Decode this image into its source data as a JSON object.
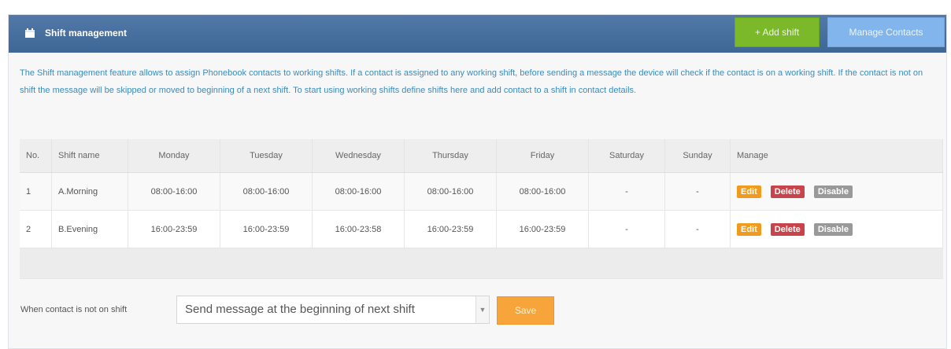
{
  "header": {
    "title": "Shift management",
    "icon": "calendar-icon",
    "add_label": "+ Add shift",
    "manage_label": "Manage Contacts"
  },
  "description": "The Shift management feature allows to assign Phonebook contacts to working shifts. If a contact is assigned to any working shift, before sending a message the device will check if the contact is on a working shift. If the contact is not on shift the message will be skipped or moved to beginning of a next shift. To start using working shifts define shifts here and add contact to a shift in contact details.",
  "table": {
    "columns": [
      "No.",
      "Shift name",
      "Monday",
      "Tuesday",
      "Wednesday",
      "Thursday",
      "Friday",
      "Saturday",
      "Sunday",
      "Manage"
    ],
    "rows": [
      {
        "no": "1",
        "name": "A.Morning",
        "mon": "08:00-16:00",
        "tue": "08:00-16:00",
        "wed": "08:00-16:00",
        "thu": "08:00-16:00",
        "fri": "08:00-16:00",
        "sat": "-",
        "sun": "-"
      },
      {
        "no": "2",
        "name": "B.Evening",
        "mon": "16:00-23:59",
        "tue": "16:00-23:59",
        "wed": "16:00-23:58",
        "thu": "16:00-23:59",
        "fri": "16:00-23:59",
        "sat": "-",
        "sun": "-"
      }
    ],
    "actions": {
      "edit": "Edit",
      "delete": "Delete",
      "disable": "Disable"
    }
  },
  "footer": {
    "label": "When contact is not on shift",
    "selected": "Send message at the beginning of next shift",
    "save_label": "Save"
  },
  "colors": {
    "header_bg": "#4a72a0",
    "add_button": "#7bb82a",
    "manage_button": "#82b5ec",
    "save_button": "#f7a53b",
    "edit": "#f09a1e",
    "delete": "#c8444a",
    "disable": "#999999",
    "description_text": "#3a8cbc"
  }
}
